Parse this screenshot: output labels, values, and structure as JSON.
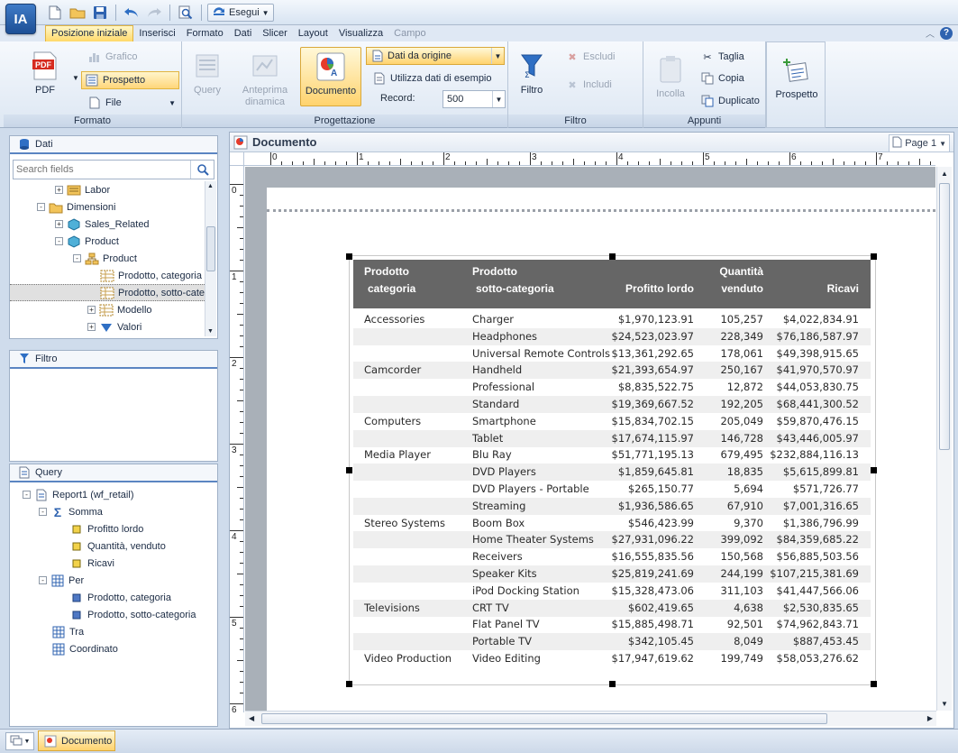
{
  "app": {
    "logo_text": "IA"
  },
  "quick_access": {
    "run_label": "Esegui"
  },
  "menu_tabs": [
    {
      "label": "Posizione iniziale",
      "state": "active"
    },
    {
      "label": "Inserisci",
      "state": "normal"
    },
    {
      "label": "Formato",
      "state": "normal"
    },
    {
      "label": "Dati",
      "state": "normal"
    },
    {
      "label": "Slicer",
      "state": "normal"
    },
    {
      "label": "Layout",
      "state": "normal"
    },
    {
      "label": "Visualizza",
      "state": "normal"
    },
    {
      "label": "Campo",
      "state": "disabled"
    }
  ],
  "ribbon": {
    "formato": {
      "label": "Formato",
      "pdf": "PDF",
      "grafico": "Grafico",
      "prospetto": "Prospetto",
      "file": "File"
    },
    "progettazione": {
      "label": "Progettazione",
      "query": "Query",
      "anteprima": "Anteprima dinamica",
      "documento": "Documento",
      "dati_origine": "Dati da origine",
      "dati_esempio": "Utilizza dati di esempio",
      "record_label": "Record:",
      "record_value": "500"
    },
    "filtro": {
      "label": "Filtro",
      "filtro": "Filtro",
      "escludi": "Escludi",
      "includi": "Includi"
    },
    "appunti": {
      "label": "Appunti",
      "incolla": "Incolla",
      "taglia": "Taglia",
      "copia": "Copia",
      "duplicato": "Duplicato"
    },
    "prospetto_btn": "Prospetto"
  },
  "data_panel": {
    "title": "Dati",
    "search_placeholder": "Search fields",
    "tree": [
      {
        "label": "Labor",
        "indent": 1,
        "expander": "+",
        "icon": "cube"
      },
      {
        "label": "Dimensioni",
        "indent": 0,
        "expander": "-",
        "icon": "folder"
      },
      {
        "label": "Sales_Related",
        "indent": 1,
        "expander": "+",
        "icon": "cube"
      },
      {
        "label": "Product",
        "indent": 1,
        "expander": "-",
        "icon": "cube"
      },
      {
        "label": "Product",
        "indent": 2,
        "expander": "-",
        "icon": "hierarchy"
      },
      {
        "label": "Prodotto, categoria",
        "indent": 3,
        "expander": "",
        "icon": "field"
      },
      {
        "label": "Prodotto, sotto-categoria",
        "indent": 3,
        "expander": "",
        "icon": "field",
        "selected": true
      },
      {
        "label": "Modello",
        "indent": 3,
        "expander": "+",
        "icon": "field"
      },
      {
        "label": "Valori",
        "indent": 3,
        "expander": "+",
        "icon": "triangle"
      }
    ]
  },
  "filter_panel": {
    "title": "Filtro"
  },
  "query_panel": {
    "title": "Query",
    "tree": [
      {
        "label": "Report1 (wf_retail)",
        "indent": 0,
        "expander": "-",
        "icon": "report"
      },
      {
        "label": "Somma",
        "indent": 1,
        "expander": "-",
        "icon": "sigma"
      },
      {
        "label": "Profitto lordo",
        "indent": 2,
        "expander": "",
        "icon": "measure"
      },
      {
        "label": "Quantità, venduto",
        "indent": 2,
        "expander": "",
        "icon": "measure"
      },
      {
        "label": "Ricavi",
        "indent": 2,
        "expander": "",
        "icon": "measure"
      },
      {
        "label": "Per",
        "indent": 1,
        "expander": "-",
        "icon": "grid"
      },
      {
        "label": "Prodotto, categoria",
        "indent": 2,
        "expander": "",
        "icon": "dim"
      },
      {
        "label": "Prodotto, sotto-categoria",
        "indent": 2,
        "expander": "",
        "icon": "dim"
      },
      {
        "label": "Tra",
        "indent": 1,
        "expander": "",
        "icon": "grid"
      },
      {
        "label": "Coordinato",
        "indent": 1,
        "expander": "",
        "icon": "grid"
      }
    ]
  },
  "document": {
    "title": "Documento",
    "page_label": "Page 1",
    "ruler_h": [
      "0",
      "1",
      "2",
      "3",
      "4",
      "5",
      "6",
      "7"
    ],
    "ruler_v": [
      "0",
      "1",
      "2",
      "3",
      "4",
      "5",
      "6"
    ]
  },
  "report": {
    "headers": {
      "cat_line1": "Prodotto",
      "cat_line2": "categoria",
      "sub_line1": "Prodotto",
      "sub_line2": "sotto-categoria",
      "profit": "Profitto lordo",
      "qty_line1": "Quantità",
      "qty_line2": "venduto",
      "revenue": "Ricavi"
    },
    "rows": [
      {
        "category": "Accessories",
        "subcategory": "Charger",
        "profit": "$1,970,123.91",
        "qty": "105,257",
        "revenue": "$4,022,834.91"
      },
      {
        "category": "",
        "subcategory": "Headphones",
        "profit": "$24,523,023.97",
        "qty": "228,349",
        "revenue": "$76,186,587.97"
      },
      {
        "category": "",
        "subcategory": "Universal Remote Controls",
        "profit": "$13,361,292.65",
        "qty": "178,061",
        "revenue": "$49,398,915.65"
      },
      {
        "category": "Camcorder",
        "subcategory": "Handheld",
        "profit": "$21,393,654.97",
        "qty": "250,167",
        "revenue": "$41,970,570.97"
      },
      {
        "category": "",
        "subcategory": "Professional",
        "profit": "$8,835,522.75",
        "qty": "12,872",
        "revenue": "$44,053,830.75"
      },
      {
        "category": "",
        "subcategory": "Standard",
        "profit": "$19,369,667.52",
        "qty": "192,205",
        "revenue": "$68,441,300.52"
      },
      {
        "category": "Computers",
        "subcategory": "Smartphone",
        "profit": "$15,834,702.15",
        "qty": "205,049",
        "revenue": "$59,870,476.15"
      },
      {
        "category": "",
        "subcategory": "Tablet",
        "profit": "$17,674,115.97",
        "qty": "146,728",
        "revenue": "$43,446,005.97"
      },
      {
        "category": "Media Player",
        "subcategory": "Blu Ray",
        "profit": "$51,771,195.13",
        "qty": "679,495",
        "revenue": "$232,884,116.13"
      },
      {
        "category": "",
        "subcategory": "DVD Players",
        "profit": "$1,859,645.81",
        "qty": "18,835",
        "revenue": "$5,615,899.81"
      },
      {
        "category": "",
        "subcategory": "DVD Players - Portable",
        "profit": "$265,150.77",
        "qty": "5,694",
        "revenue": "$571,726.77"
      },
      {
        "category": "",
        "subcategory": "Streaming",
        "profit": "$1,936,586.65",
        "qty": "67,910",
        "revenue": "$7,001,316.65"
      },
      {
        "category": "Stereo Systems",
        "subcategory": "Boom Box",
        "profit": "$546,423.99",
        "qty": "9,370",
        "revenue": "$1,386,796.99"
      },
      {
        "category": "",
        "subcategory": "Home Theater Systems",
        "profit": "$27,931,096.22",
        "qty": "399,092",
        "revenue": "$84,359,685.22"
      },
      {
        "category": "",
        "subcategory": "Receivers",
        "profit": "$16,555,835.56",
        "qty": "150,568",
        "revenue": "$56,885,503.56"
      },
      {
        "category": "",
        "subcategory": "Speaker Kits",
        "profit": "$25,819,241.69",
        "qty": "244,199",
        "revenue": "$107,215,381.69"
      },
      {
        "category": "",
        "subcategory": "iPod Docking Station",
        "profit": "$15,328,473.06",
        "qty": "311,103",
        "revenue": "$41,447,566.06"
      },
      {
        "category": "Televisions",
        "subcategory": "CRT TV",
        "profit": "$602,419.65",
        "qty": "4,638",
        "revenue": "$2,530,835.65"
      },
      {
        "category": "",
        "subcategory": "Flat Panel TV",
        "profit": "$15,885,498.71",
        "qty": "92,501",
        "revenue": "$74,962,843.71"
      },
      {
        "category": "",
        "subcategory": "Portable TV",
        "profit": "$342,105.45",
        "qty": "8,049",
        "revenue": "$887,453.45"
      },
      {
        "category": "Video Production",
        "subcategory": "Video Editing",
        "profit": "$17,947,619.62",
        "qty": "199,749",
        "revenue": "$58,053,276.62"
      }
    ]
  },
  "taskbar": {
    "doc_tab": "Documento"
  },
  "colors": {
    "accent": "#5b85c2",
    "active_tab": "#ffd96a",
    "report_header": "#666666",
    "report_alt_row": "#efefef"
  }
}
